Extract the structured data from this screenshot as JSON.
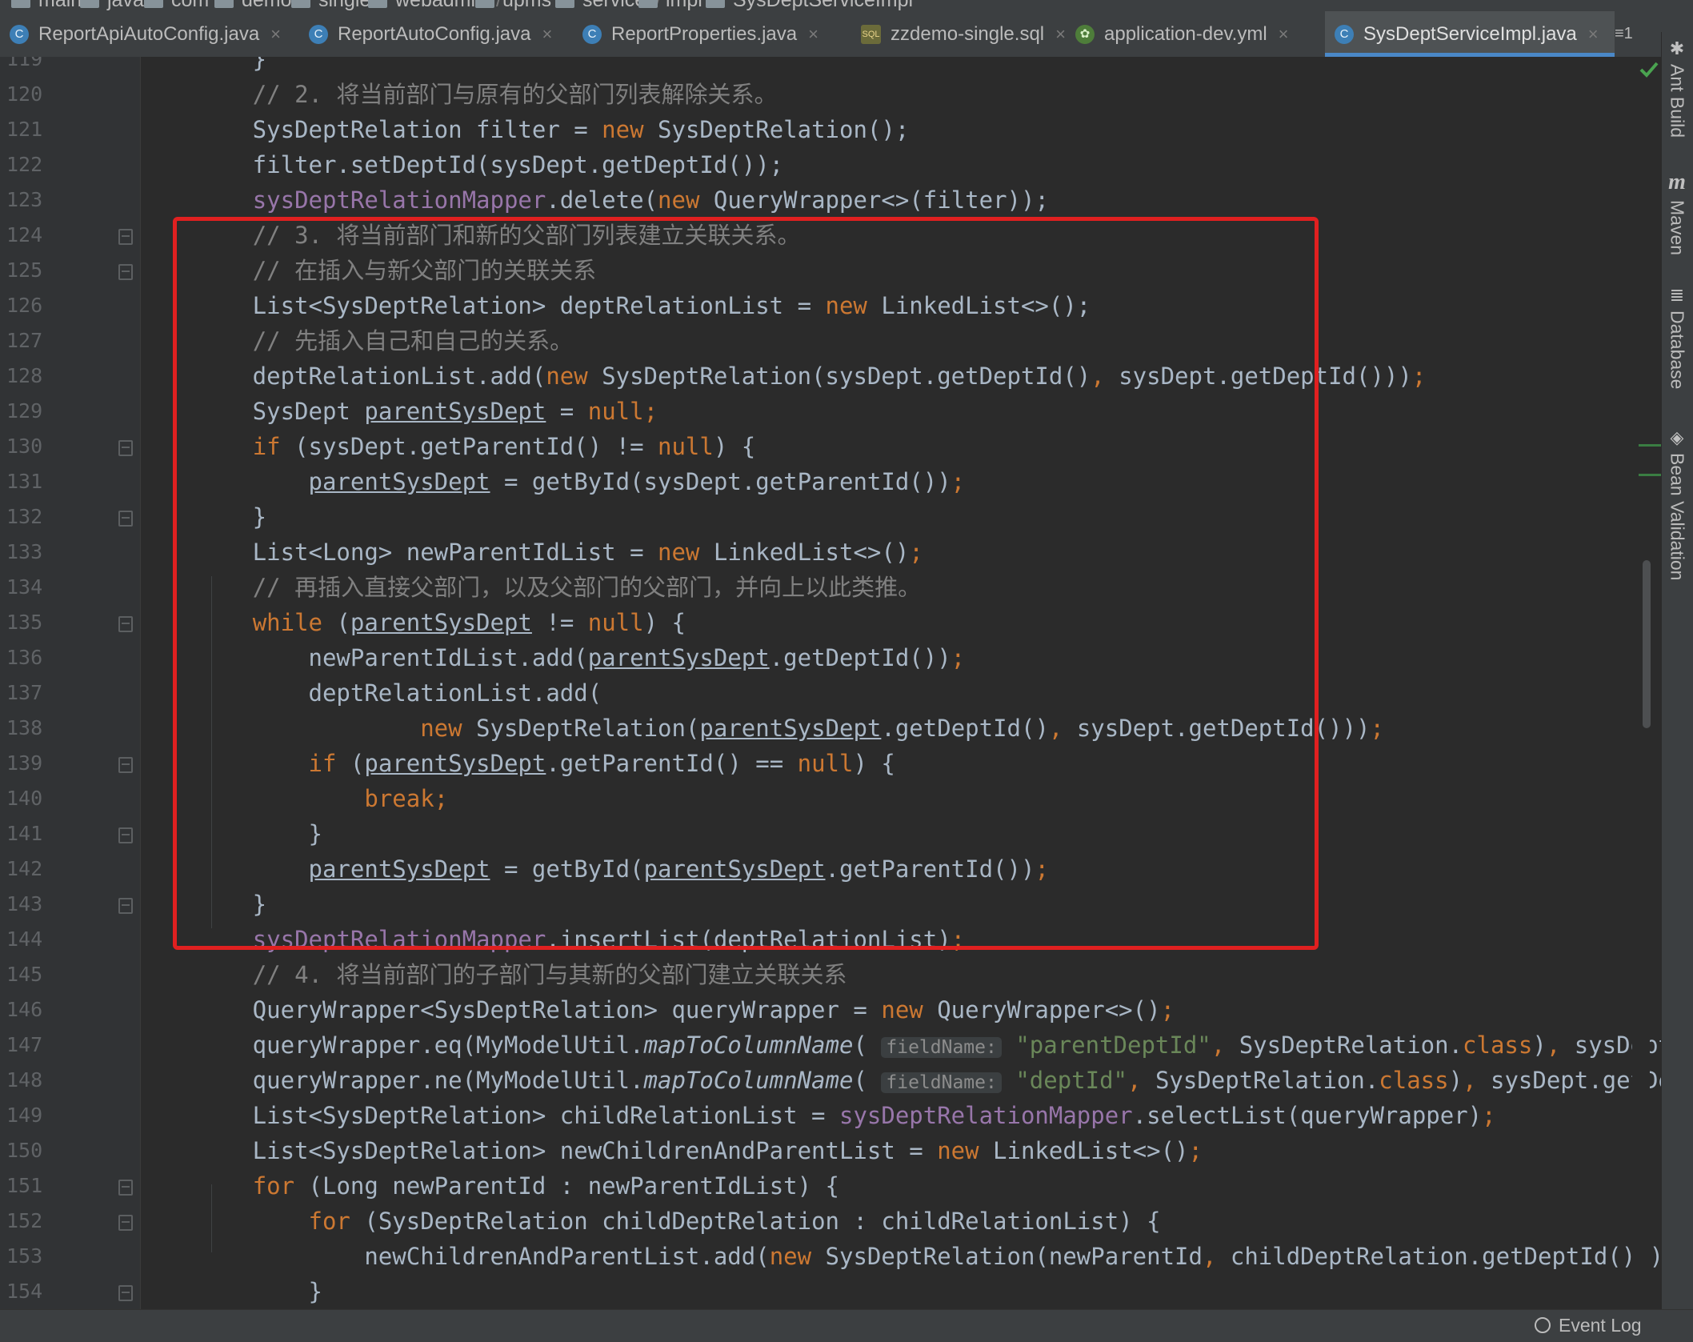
{
  "breadcrumb": [
    "main",
    "java",
    "com",
    "demo",
    "single",
    "webadmin",
    "upms",
    "service",
    "impl",
    "SysDeptServiceImpl"
  ],
  "tabs": [
    {
      "label": "ReportApiAutoConfig.java",
      "icon": "java-class-icon",
      "active": false
    },
    {
      "label": "ReportAutoConfig.java",
      "icon": "java-class-icon",
      "active": false
    },
    {
      "label": "ReportProperties.java",
      "icon": "java-class-icon",
      "active": false
    },
    {
      "label": "zzdemo-single.sql",
      "icon": "sql-file-icon",
      "active": false
    },
    {
      "label": "application-dev.yml",
      "icon": "yaml-file-icon",
      "active": false
    },
    {
      "label": "SysDeptServiceImpl.java",
      "icon": "java-class-icon",
      "active": true
    }
  ],
  "tab_overflow_label": "≡1",
  "right_tools": [
    "Ant Build",
    "Maven",
    "Database",
    "Bean Validation"
  ],
  "status_bar": {
    "event_log_label": "Event Log"
  },
  "colors": {
    "editor_bg": "#2b2b2b",
    "keyword": "#cc7832",
    "comment": "#808080",
    "field": "#9876aa",
    "string": "#6a8759",
    "highlight_box": "#e02020",
    "active_tab_underline": "#4a88c7"
  },
  "code": {
    "lines": [
      {
        "n": "119",
        "tokens": [
          [
            "p",
            "        }"
          ]
        ]
      },
      {
        "n": "120",
        "tokens": [
          [
            "p",
            "        "
          ],
          [
            "cm",
            "// 2. 将当前部门与原有的父部门列表解除关系。"
          ]
        ]
      },
      {
        "n": "121",
        "tokens": [
          [
            "p",
            "        SysDeptRelation filter = "
          ],
          [
            "kw",
            "new"
          ],
          [
            "p",
            " SysDeptRelation();"
          ]
        ]
      },
      {
        "n": "122",
        "tokens": [
          [
            "p",
            "        filter.setDeptId(sysDept.getDeptId());"
          ]
        ]
      },
      {
        "n": "123",
        "tokens": [
          [
            "p",
            "        "
          ],
          [
            "fd",
            "sysDeptRelationMapper"
          ],
          [
            "p",
            ".delete("
          ],
          [
            "kw",
            "new"
          ],
          [
            "p",
            " QueryWrapper<>(filter));"
          ]
        ]
      },
      {
        "n": "124",
        "tokens": [
          [
            "p",
            "        "
          ],
          [
            "cm",
            "// 3. 将当前部门和新的父部门列表建立关联关系。"
          ]
        ]
      },
      {
        "n": "125",
        "tokens": [
          [
            "p",
            "        "
          ],
          [
            "cm",
            "// 在插入与新父部门的关联关系"
          ]
        ]
      },
      {
        "n": "126",
        "tokens": [
          [
            "p",
            "        List<SysDeptRelation> deptRelationList = "
          ],
          [
            "kw",
            "new"
          ],
          [
            "p",
            " LinkedList<>();"
          ]
        ]
      },
      {
        "n": "127",
        "tokens": [
          [
            "p",
            "        "
          ],
          [
            "cm",
            "// 先插入自己和自己的关系。"
          ]
        ]
      },
      {
        "n": "128",
        "tokens": [
          [
            "p",
            "        deptRelationList.add("
          ],
          [
            "kw",
            "new"
          ],
          [
            "p",
            " SysDeptRelation(sysDept.getDeptId()"
          ],
          [
            "kw",
            ","
          ],
          [
            "p",
            " sysDept.getDeptId()))"
          ],
          [
            "kw",
            ";"
          ]
        ]
      },
      {
        "n": "129",
        "tokens": [
          [
            "p",
            "        SysDept "
          ],
          [
            "ul",
            "parentSysDept"
          ],
          [
            "p",
            " = "
          ],
          [
            "kw",
            "null;"
          ]
        ]
      },
      {
        "n": "130",
        "tokens": [
          [
            "p",
            "        "
          ],
          [
            "kw",
            "if"
          ],
          [
            "p",
            " (sysDept.getParentId() != "
          ],
          [
            "kw",
            "null"
          ],
          [
            "p",
            ") {"
          ]
        ]
      },
      {
        "n": "131",
        "tokens": [
          [
            "p",
            "            "
          ],
          [
            "ul",
            "parentSysDept"
          ],
          [
            "p",
            " = getById(sysDept.getParentId())"
          ],
          [
            "kw",
            ";"
          ]
        ]
      },
      {
        "n": "132",
        "tokens": [
          [
            "p",
            "        }"
          ]
        ]
      },
      {
        "n": "133",
        "tokens": [
          [
            "p",
            "        List<Long> newParentIdList = "
          ],
          [
            "kw",
            "new"
          ],
          [
            "p",
            " LinkedList<>()"
          ],
          [
            "kw",
            ";"
          ]
        ]
      },
      {
        "n": "134",
        "tokens": [
          [
            "p",
            "        "
          ],
          [
            "cm",
            "// 再插入直接父部门，以及父部门的父部门，并向上以此类推。"
          ]
        ]
      },
      {
        "n": "135",
        "tokens": [
          [
            "p",
            "        "
          ],
          [
            "kw",
            "while"
          ],
          [
            "p",
            " ("
          ],
          [
            "ul",
            "parentSysDept"
          ],
          [
            "p",
            " != "
          ],
          [
            "kw",
            "null"
          ],
          [
            "p",
            ") {"
          ]
        ]
      },
      {
        "n": "136",
        "tokens": [
          [
            "p",
            "            newParentIdList.add("
          ],
          [
            "ul",
            "parentSysDept"
          ],
          [
            "p",
            ".getDeptId())"
          ],
          [
            "kw",
            ";"
          ]
        ]
      },
      {
        "n": "137",
        "tokens": [
          [
            "p",
            "            deptRelationList.add("
          ]
        ]
      },
      {
        "n": "138",
        "tokens": [
          [
            "p",
            "                    "
          ],
          [
            "kw",
            "new"
          ],
          [
            "p",
            " SysDeptRelation("
          ],
          [
            "ul",
            "parentSysDept"
          ],
          [
            "p",
            ".getDeptId()"
          ],
          [
            "kw",
            ","
          ],
          [
            "p",
            " sysDept.getDeptId()))"
          ],
          [
            "kw",
            ";"
          ]
        ]
      },
      {
        "n": "139",
        "tokens": [
          [
            "p",
            "            "
          ],
          [
            "kw",
            "if"
          ],
          [
            "p",
            " ("
          ],
          [
            "ul",
            "parentSysDept"
          ],
          [
            "p",
            ".getParentId() == "
          ],
          [
            "kw",
            "null"
          ],
          [
            "p",
            ") {"
          ]
        ]
      },
      {
        "n": "140",
        "tokens": [
          [
            "p",
            "                "
          ],
          [
            "kw",
            "break;"
          ]
        ]
      },
      {
        "n": "141",
        "tokens": [
          [
            "p",
            "            }"
          ]
        ]
      },
      {
        "n": "142",
        "tokens": [
          [
            "p",
            "            "
          ],
          [
            "ul",
            "parentSysDept"
          ],
          [
            "p",
            " = getById("
          ],
          [
            "ul",
            "parentSysDept"
          ],
          [
            "p",
            ".getParentId())"
          ],
          [
            "kw",
            ";"
          ]
        ]
      },
      {
        "n": "143",
        "tokens": [
          [
            "p",
            "        }"
          ]
        ]
      },
      {
        "n": "144",
        "tokens": [
          [
            "p",
            "        "
          ],
          [
            "fd",
            "sysDeptRelationMapper"
          ],
          [
            "p",
            ".insertList(deptRelationList)"
          ],
          [
            "kw",
            ";"
          ]
        ]
      },
      {
        "n": "145",
        "tokens": [
          [
            "p",
            "        "
          ],
          [
            "cm",
            "// 4. 将当前部门的子部门与其新的父部门建立关联关系"
          ]
        ]
      },
      {
        "n": "146",
        "tokens": [
          [
            "p",
            "        QueryWrapper<SysDeptRelation> queryWrapper = "
          ],
          [
            "kw",
            "new"
          ],
          [
            "p",
            " QueryWrapper<>()"
          ],
          [
            "kw",
            ";"
          ]
        ]
      },
      {
        "n": "147",
        "tokens": [
          [
            "p",
            "        queryWrapper.eq(MyModelUtil."
          ],
          [
            "it",
            "mapToColumnName"
          ],
          [
            "p",
            "( "
          ],
          [
            "hint",
            "fieldName:"
          ],
          [
            "p",
            " "
          ],
          [
            "st",
            "\"parentDeptId\""
          ],
          [
            "kw",
            ","
          ],
          [
            "p",
            " SysDeptRelation."
          ],
          [
            "kw",
            "class"
          ],
          [
            "p",
            ")"
          ],
          [
            "kw",
            ","
          ],
          [
            "p",
            " sysDept.getDeptId("
          ]
        ]
      },
      {
        "n": "148",
        "tokens": [
          [
            "p",
            "        queryWrapper.ne(MyModelUtil."
          ],
          [
            "it",
            "mapToColumnName"
          ],
          [
            "p",
            "( "
          ],
          [
            "hint",
            "fieldName:"
          ],
          [
            "p",
            " "
          ],
          [
            "st",
            "\"deptId\""
          ],
          [
            "kw",
            ","
          ],
          [
            "p",
            " SysDeptRelation."
          ],
          [
            "kw",
            "class"
          ],
          [
            "p",
            ")"
          ],
          [
            "kw",
            ","
          ],
          [
            "p",
            " sysDept.getDeptId())"
          ],
          [
            "kw",
            ";"
          ]
        ]
      },
      {
        "n": "149",
        "tokens": [
          [
            "p",
            "        List<SysDeptRelation> childRelationList = "
          ],
          [
            "fd",
            "sysDeptRelationMapper"
          ],
          [
            "p",
            ".selectList(queryWrapper)"
          ],
          [
            "kw",
            ";"
          ]
        ]
      },
      {
        "n": "150",
        "tokens": [
          [
            "p",
            "        List<SysDeptRelation> newChildrenAndParentList = "
          ],
          [
            "kw",
            "new"
          ],
          [
            "p",
            " LinkedList<>()"
          ],
          [
            "kw",
            ";"
          ]
        ]
      },
      {
        "n": "151",
        "tokens": [
          [
            "p",
            "        "
          ],
          [
            "kw",
            "for"
          ],
          [
            "p",
            " (Long newParentId : newParentIdList) {"
          ]
        ]
      },
      {
        "n": "152",
        "tokens": [
          [
            "p",
            "            "
          ],
          [
            "kw",
            "for"
          ],
          [
            "p",
            " (SysDeptRelation childDeptRelation : childRelationList) {"
          ]
        ]
      },
      {
        "n": "153",
        "tokens": [
          [
            "p",
            "                newChildrenAndParentList.add("
          ],
          [
            "kw",
            "new"
          ],
          [
            "p",
            " SysDeptRelation(newParentId"
          ],
          [
            "kw",
            ","
          ],
          [
            "p",
            " childDeptRelation.getDeptId()))"
          ],
          [
            "kw",
            ";"
          ]
        ]
      },
      {
        "n": "154",
        "tokens": [
          [
            "p",
            "            }"
          ]
        ]
      }
    ]
  }
}
